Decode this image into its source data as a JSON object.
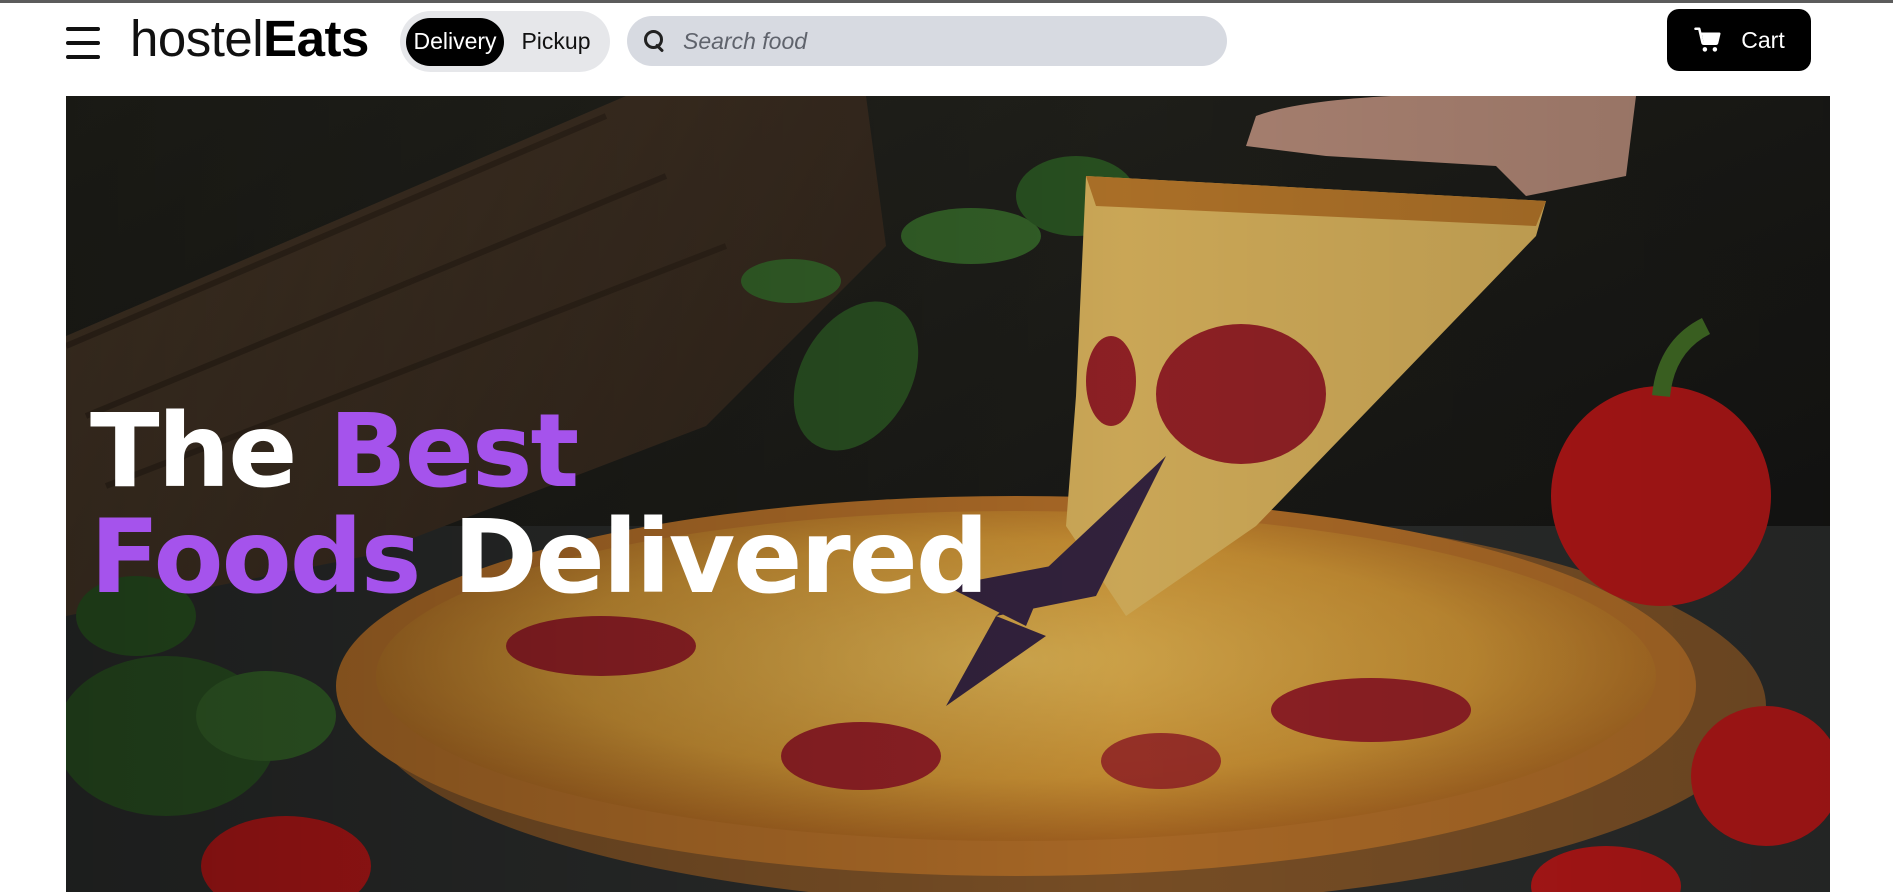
{
  "header": {
    "menu_icon": "hamburger-menu-icon",
    "logo": {
      "light": "hostel",
      "bold": "Eats"
    },
    "mode_toggle": {
      "options": [
        "Delivery",
        "Pickup"
      ],
      "selected": "Delivery"
    },
    "search": {
      "placeholder": "Search food",
      "value": "",
      "icon": "search-icon"
    },
    "cart": {
      "label": "Cart",
      "icon": "shopping-cart-icon"
    }
  },
  "hero": {
    "headline": {
      "line1_white": "The",
      "line1_accent": "Best",
      "line2_accent": "Foods",
      "line2_white": "Delivered"
    },
    "accent_color": "#a553ec",
    "image": "pizza-hero-image"
  }
}
